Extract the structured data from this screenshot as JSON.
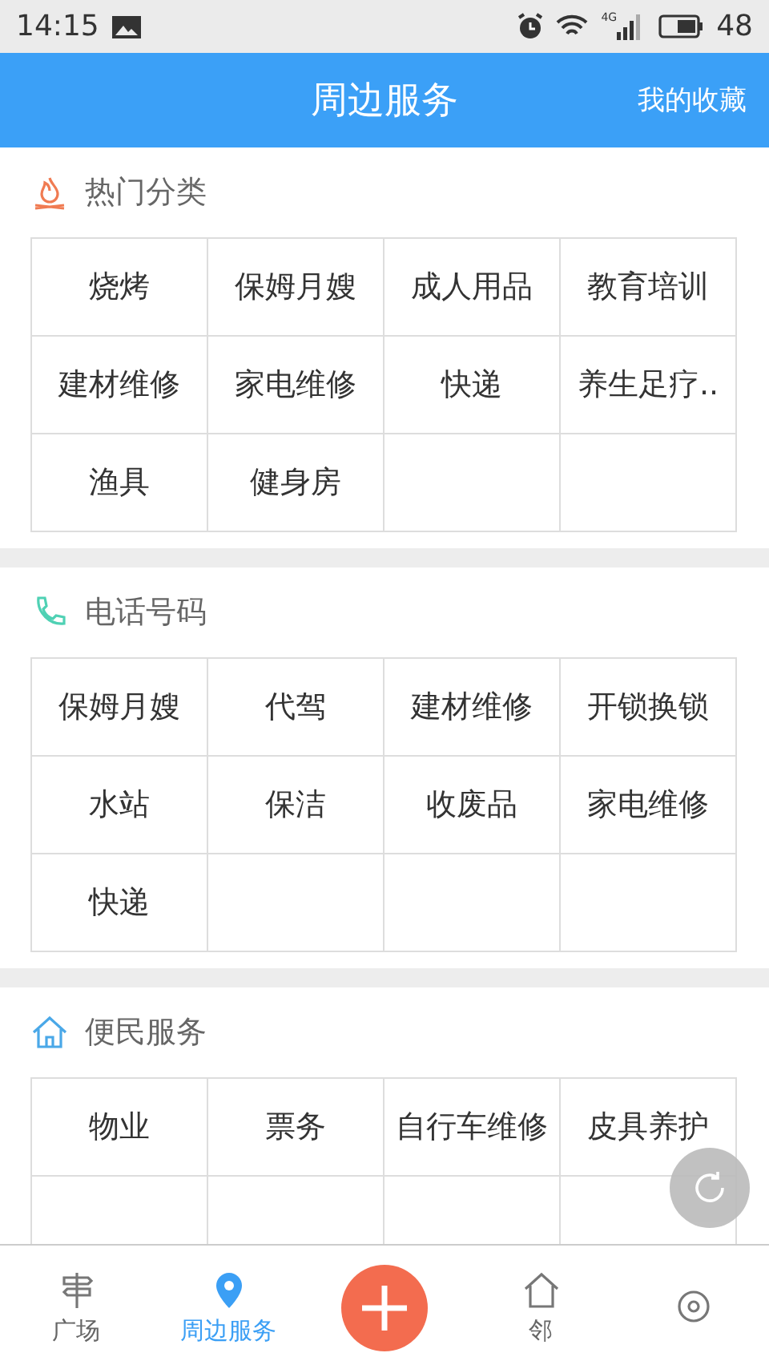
{
  "status_bar": {
    "time": "14:15",
    "network": "4G",
    "battery": "48"
  },
  "header": {
    "title": "周边服务",
    "action": "我的收藏"
  },
  "sections": [
    {
      "title": "热门分类",
      "color": "#f07b52",
      "truncated": false,
      "items": [
        "烧烤",
        "保姆月嫂",
        "成人用品",
        "教育培训",
        "建材维修",
        "家电维修",
        "快递",
        "养生足疗..",
        "渔具",
        "健身房"
      ]
    },
    {
      "title": "电话号码",
      "color": "#4fd1b4",
      "truncated": false,
      "items": [
        "保姆月嫂",
        "代驾",
        "建材维修",
        "开锁换锁",
        "水站",
        "保洁",
        "收废品",
        "家电维修",
        "快递"
      ]
    },
    {
      "title": "便民服务",
      "color": "#4aa8e8",
      "truncated": true,
      "items": [
        "物业",
        "票务",
        "自行车维修",
        "皮具养护"
      ]
    }
  ],
  "nav": [
    {
      "kind": "tab",
      "label": "广场",
      "selected": false
    },
    {
      "kind": "tab",
      "label": "周边服务",
      "selected": true
    },
    {
      "kind": "add"
    },
    {
      "kind": "tab",
      "label": "邻",
      "selected": false
    },
    {
      "kind": "tab",
      "selected": false
    }
  ]
}
